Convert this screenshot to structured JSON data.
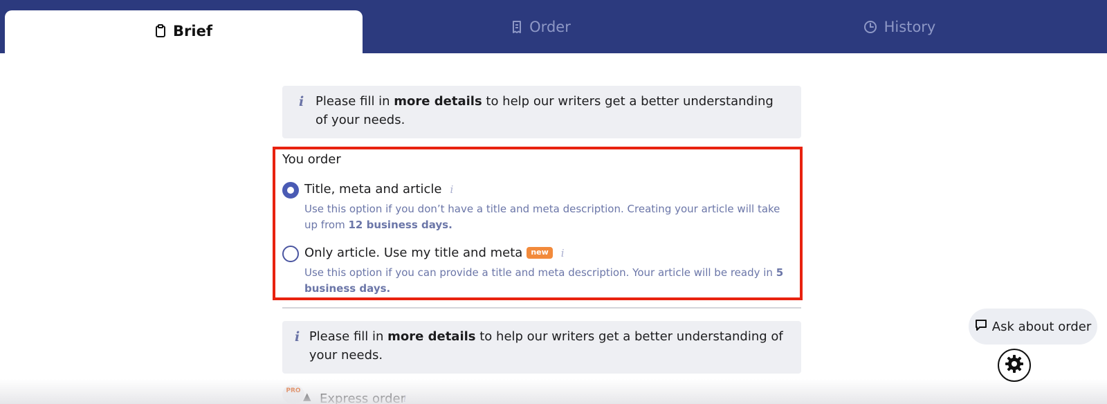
{
  "tabs": [
    {
      "label": "Brief",
      "icon": "clipboard-icon",
      "active": true
    },
    {
      "label": "Order",
      "icon": "receipt-icon",
      "active": false
    },
    {
      "label": "History",
      "icon": "clock-icon",
      "active": false
    }
  ],
  "notice_top": {
    "prefix": "Please fill in ",
    "bold": "more details",
    "suffix": " to help our writers get a better understanding of your needs."
  },
  "order_section": {
    "label": "You order",
    "options": [
      {
        "title": "Title, meta and article",
        "selected": true,
        "desc_prefix": "Use this option if you don’t have a title and meta description. Creating your article will take up from ",
        "desc_bold": "12 business days."
      },
      {
        "title": "Only article. Use my title and meta",
        "badge": "new",
        "selected": false,
        "desc_prefix": "Use this option if you can provide a title and meta description. Your article will be ready in ",
        "desc_bold": "5 business days."
      }
    ]
  },
  "notice_bottom": {
    "prefix": "Please fill in ",
    "bold": "more details",
    "suffix": " to help our writers get a better understanding of your needs."
  },
  "express": {
    "pro_label": "PRO",
    "label": "Express order"
  },
  "ask_button": {
    "label": "Ask about order"
  },
  "colors": {
    "nav_bg": "#2c3a7e",
    "highlight": "#e8220f",
    "accent": "#4a5bb4",
    "badge": "#f28a3b"
  }
}
